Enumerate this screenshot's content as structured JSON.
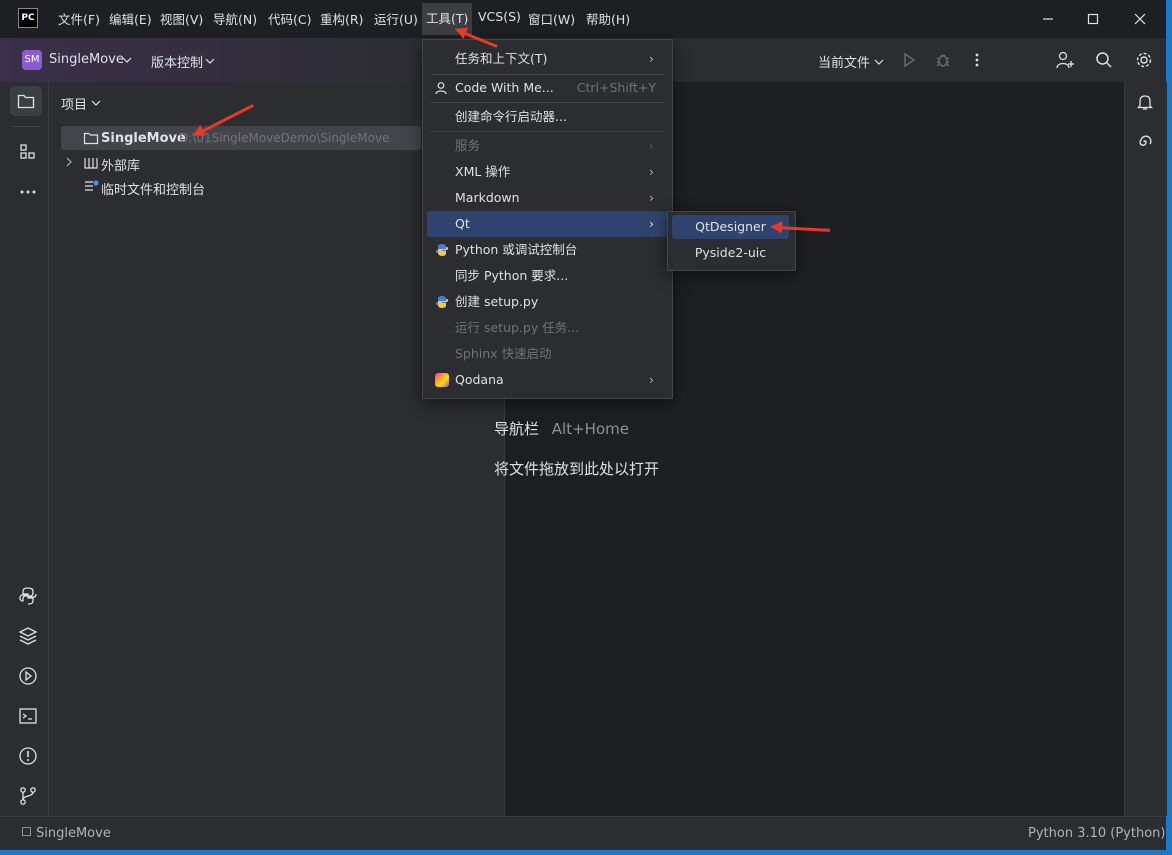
{
  "app": {
    "logo_text": "PC"
  },
  "menubar": {
    "items": [
      {
        "label": "文件(F)"
      },
      {
        "label": "编辑(E)"
      },
      {
        "label": "视图(V)"
      },
      {
        "label": "导航(N)"
      },
      {
        "label": "代码(C)"
      },
      {
        "label": "重构(R)"
      },
      {
        "label": "运行(U)"
      },
      {
        "label": "工具(T)"
      },
      {
        "label": "VCS(S)"
      },
      {
        "label": "窗口(W)"
      },
      {
        "label": "帮助(H)"
      }
    ]
  },
  "toolbar": {
    "project_badge": "SM",
    "project_name": "SingleMove",
    "vcs_label": "版本控制",
    "run_config": "当前文件"
  },
  "project_panel": {
    "title": "项目",
    "tree": [
      {
        "label": "SingleMove",
        "path": "D:\\01SingleMoveDemo\\SingleMove"
      },
      {
        "label": "外部库"
      },
      {
        "label": "临时文件和控制台"
      }
    ]
  },
  "editor": {
    "hint_nav": "导航栏",
    "hint_nav_shortcut": "Alt+Home",
    "hint_drop": "将文件拖放到此处以打开"
  },
  "tools_menu": {
    "items": [
      {
        "label": "任务和上下文(T)"
      },
      {
        "label": "Code With Me...",
        "shortcut": "Ctrl+Shift+Y"
      },
      {
        "label": "创建命令行启动器..."
      },
      {
        "label": "服务"
      },
      {
        "label": "XML 操作"
      },
      {
        "label": "Markdown"
      },
      {
        "label": "Qt"
      },
      {
        "label": "Python 或调试控制台"
      },
      {
        "label": "同步 Python 要求..."
      },
      {
        "label": "创建 setup.py"
      },
      {
        "label": "运行 setup.py 任务..."
      },
      {
        "label": "Sphinx 快速启动"
      },
      {
        "label": "Qodana"
      }
    ]
  },
  "qt_submenu": {
    "items": [
      {
        "label": "QtDesigner"
      },
      {
        "label": "Pyside2-uic"
      }
    ]
  },
  "statusbar": {
    "project": "SingleMove",
    "interpreter": "Python 3.10 (Python)"
  },
  "colors": {
    "accent": "#2e436e",
    "arrow": "#e8372b",
    "badge": "#8a5cd1",
    "window_border": "#1e78c8"
  }
}
